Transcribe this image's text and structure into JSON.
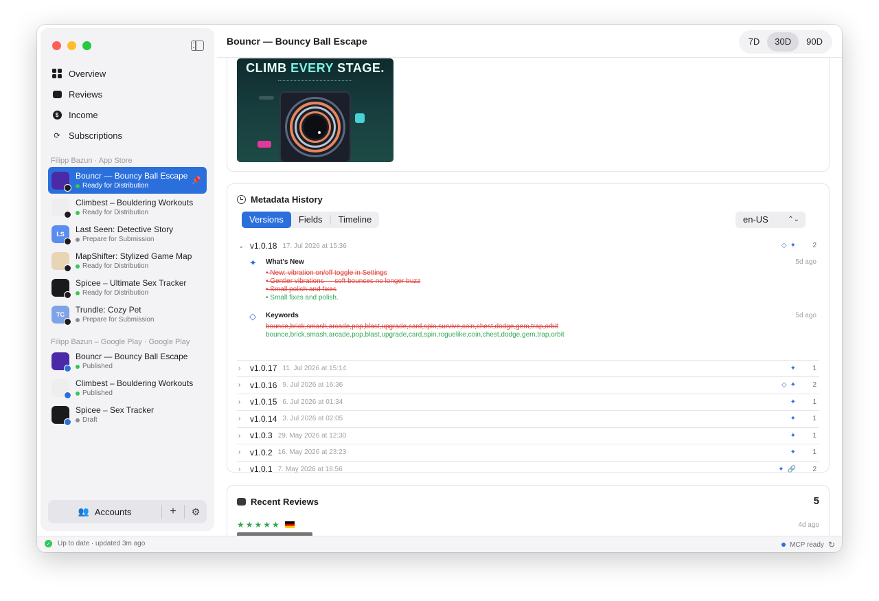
{
  "window": {
    "title": "Bouncr — Bouncy Ball Escape"
  },
  "range": {
    "options": [
      "7D",
      "30D",
      "90D"
    ],
    "selected": "30D"
  },
  "nav": [
    {
      "label": "Overview",
      "icon": "grid-icon"
    },
    {
      "label": "Reviews",
      "icon": "bubble-icon"
    },
    {
      "label": "Income",
      "icon": "dollar-coin-icon"
    },
    {
      "label": "Subscriptions",
      "icon": "sync-icon"
    }
  ],
  "sections": {
    "app_store": "Filipp Bazun · App Store",
    "google_play": "Filipp Bazun – Google Play · Google Play"
  },
  "app_store_apps": [
    {
      "name": "Bouncr — Bouncy Ball Escape",
      "status": "Ready for Distribution",
      "dot": "green",
      "selected": true,
      "pinned": true,
      "icon_bg": "#4b2aa8",
      "initials": ""
    },
    {
      "name": "Climbest – Bouldering Workouts",
      "status": "Ready for Distribution",
      "dot": "green",
      "icon_bg": "#eeeeee",
      "initials": ""
    },
    {
      "name": "Last Seen: Detective Story",
      "status": "Prepare for Submission",
      "dot": "gray",
      "icon_bg": "#5b8def",
      "initials": "LS"
    },
    {
      "name": "MapShifter: Stylized Game Map",
      "status": "Ready for Distribution",
      "dot": "green",
      "icon_bg": "#e8d5b5",
      "initials": ""
    },
    {
      "name": "Spicee – Ultimate Sex Tracker",
      "status": "Ready for Distribution",
      "dot": "green",
      "icon_bg": "#1a1a1a",
      "initials": ""
    },
    {
      "name": "Trundle: Cozy Pet",
      "status": "Prepare for Submission",
      "dot": "gray",
      "icon_bg": "#7fa3e8",
      "initials": "TC"
    }
  ],
  "google_play_apps": [
    {
      "name": "Bouncr — Bouncy Ball Escape",
      "status": "Published",
      "dot": "green",
      "icon_bg": "#4b2aa8",
      "initials": ""
    },
    {
      "name": "Climbest – Bouldering Workouts",
      "status": "Published",
      "dot": "green",
      "icon_bg": "#eeeeee",
      "initials": ""
    },
    {
      "name": "Spicee – Sex Tracker",
      "status": "Draft",
      "dot": "gray",
      "icon_bg": "#1a1a1a",
      "initials": ""
    }
  ],
  "accounts": {
    "label": "Accounts"
  },
  "promo": {
    "title_a": "CLIMB ",
    "title_b": "EVERY",
    "title_c": " STAGE."
  },
  "metadata": {
    "title": "Metadata History",
    "tabs": [
      "Versions",
      "Fields",
      "Timeline"
    ],
    "active_tab": "Versions",
    "locale": "en-US",
    "expanded": {
      "version": "v1.0.18",
      "date": "17. Jul 2026 at 15:36",
      "count": "2",
      "whats_new": {
        "title": "What's New",
        "ago": "5d ago",
        "removed": [
          "• New: vibration on/off toggle in Settings",
          "• Gentler vibrations — soft bounces no longer buzz",
          "• Small polish and fixes"
        ],
        "added": [
          "• Small fixes and polish."
        ]
      },
      "keywords": {
        "title": "Keywords",
        "ago": "5d ago",
        "removed": "bounce,brick,smash,arcade,pop,blast,upgrade,card,spin,survive,coin,chest,dodge,gem,trap,orbit",
        "added": "bounce,brick,smash,arcade,pop,blast,upgrade,card,spin,roguelike,coin,chest,dodge,gem,trap,orbit"
      }
    },
    "versions": [
      {
        "version": "v1.0.17",
        "date": "11. Jul 2026 at 15:14",
        "count": "1",
        "icons": [
          "sparkle"
        ]
      },
      {
        "version": "v1.0.16",
        "date": "9. Jul 2026 at 16:36",
        "count": "2",
        "icons": [
          "tag",
          "sparkle"
        ]
      },
      {
        "version": "v1.0.15",
        "date": "6. Jul 2026 at 01:34",
        "count": "1",
        "icons": [
          "sparkle"
        ]
      },
      {
        "version": "v1.0.14",
        "date": "3. Jul 2026 at 02:05",
        "count": "1",
        "icons": [
          "sparkle"
        ]
      },
      {
        "version": "v1.0.3",
        "date": "29. May 2026 at 12:30",
        "count": "1",
        "icons": [
          "sparkle"
        ]
      },
      {
        "version": "v1.0.2",
        "date": "16. May 2026 at 23:23",
        "count": "1",
        "icons": [
          "sparkle"
        ]
      },
      {
        "version": "v1.0.1",
        "date": "7. May 2026 at 16:56",
        "count": "2",
        "icons": [
          "sparkle",
          "link"
        ]
      }
    ]
  },
  "reviews": {
    "title": "Recent Reviews",
    "count": "5",
    "stars": "★★★★★",
    "ago": "4d ago"
  },
  "status": {
    "left": "Up to date · updated 3m ago",
    "right": "MCP ready"
  },
  "colors": {
    "accent": "#2b6fdc",
    "added": "#34a853",
    "removed": "#e0443e"
  }
}
